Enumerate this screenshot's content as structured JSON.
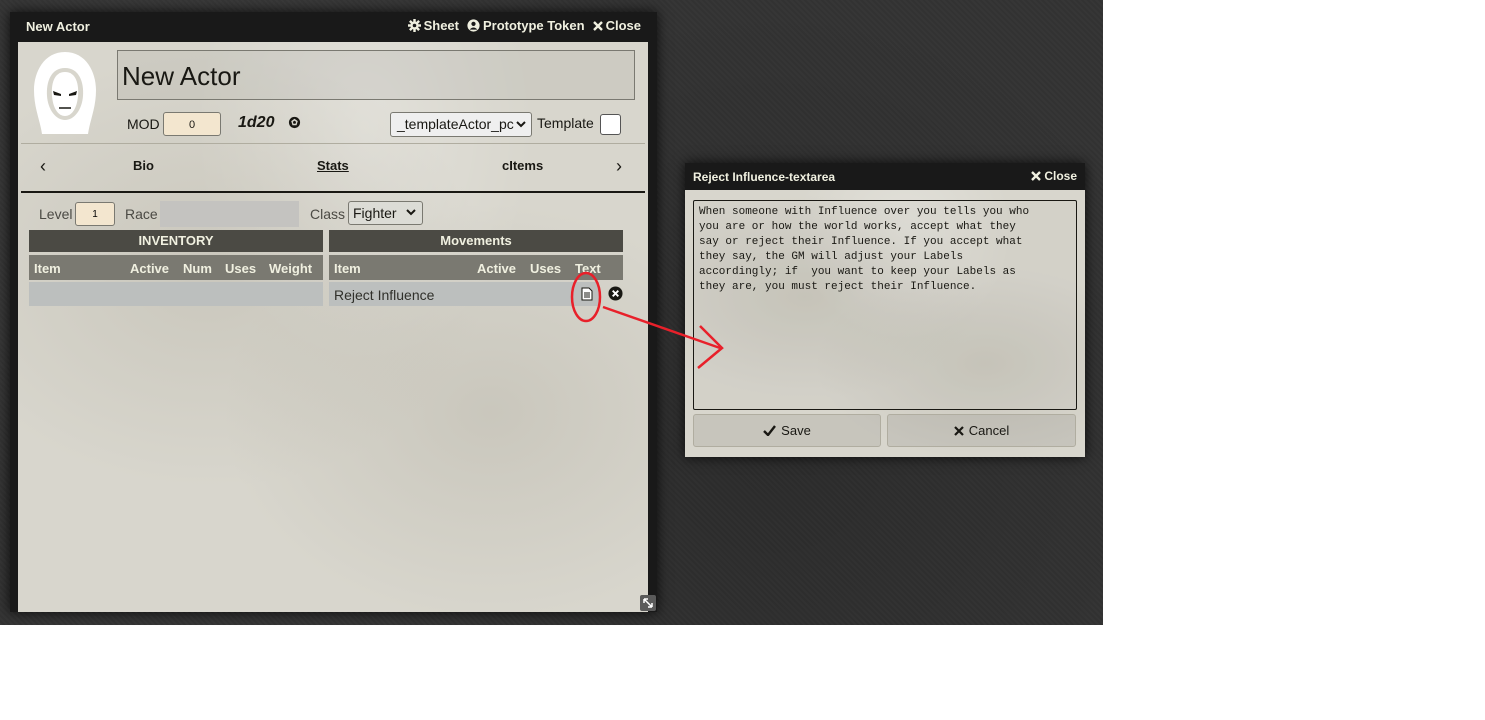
{
  "actor_window": {
    "title": "New Actor",
    "controls": {
      "sheet": "Sheet",
      "token": "Prototype Token",
      "close": "Close"
    },
    "name": "New Actor",
    "mod_label": "MOD",
    "mod_value": "0",
    "dice_formula": "1d20",
    "template_select": "_templateActor_pc",
    "template_label": "Template",
    "tabs": [
      "Bio",
      "Stats",
      "cItems"
    ],
    "level_label": "Level",
    "level_value": "1",
    "race_label": "Race",
    "class_label": "Class",
    "class_value": "Fighter",
    "inventory": {
      "title": "INVENTORY",
      "headers": [
        "Item",
        "Active",
        "Num",
        "Uses",
        "Weight"
      ]
    },
    "movements": {
      "title": "Movements",
      "headers": [
        "Item",
        "Active",
        "Uses",
        "Text"
      ],
      "rows": [
        {
          "item": "Reject Influence"
        }
      ]
    }
  },
  "dialog": {
    "title": "Reject Influence-textarea",
    "close": "Close",
    "text": "When someone with Influence over you tells you who\nyou are or how the world works, accept what they\nsay or reject their Influence. If you accept what\nthey say, the GM will adjust your Labels\naccordingly; if  you want to keep your Labels as\nthey are, you must reject their Influence.",
    "save": "Save",
    "cancel": "Cancel"
  },
  "colors": {
    "annotation": "#e8202a",
    "header": "#4b4a44",
    "subheader": "#7a7971",
    "input_bg": "#f3e6cf"
  }
}
